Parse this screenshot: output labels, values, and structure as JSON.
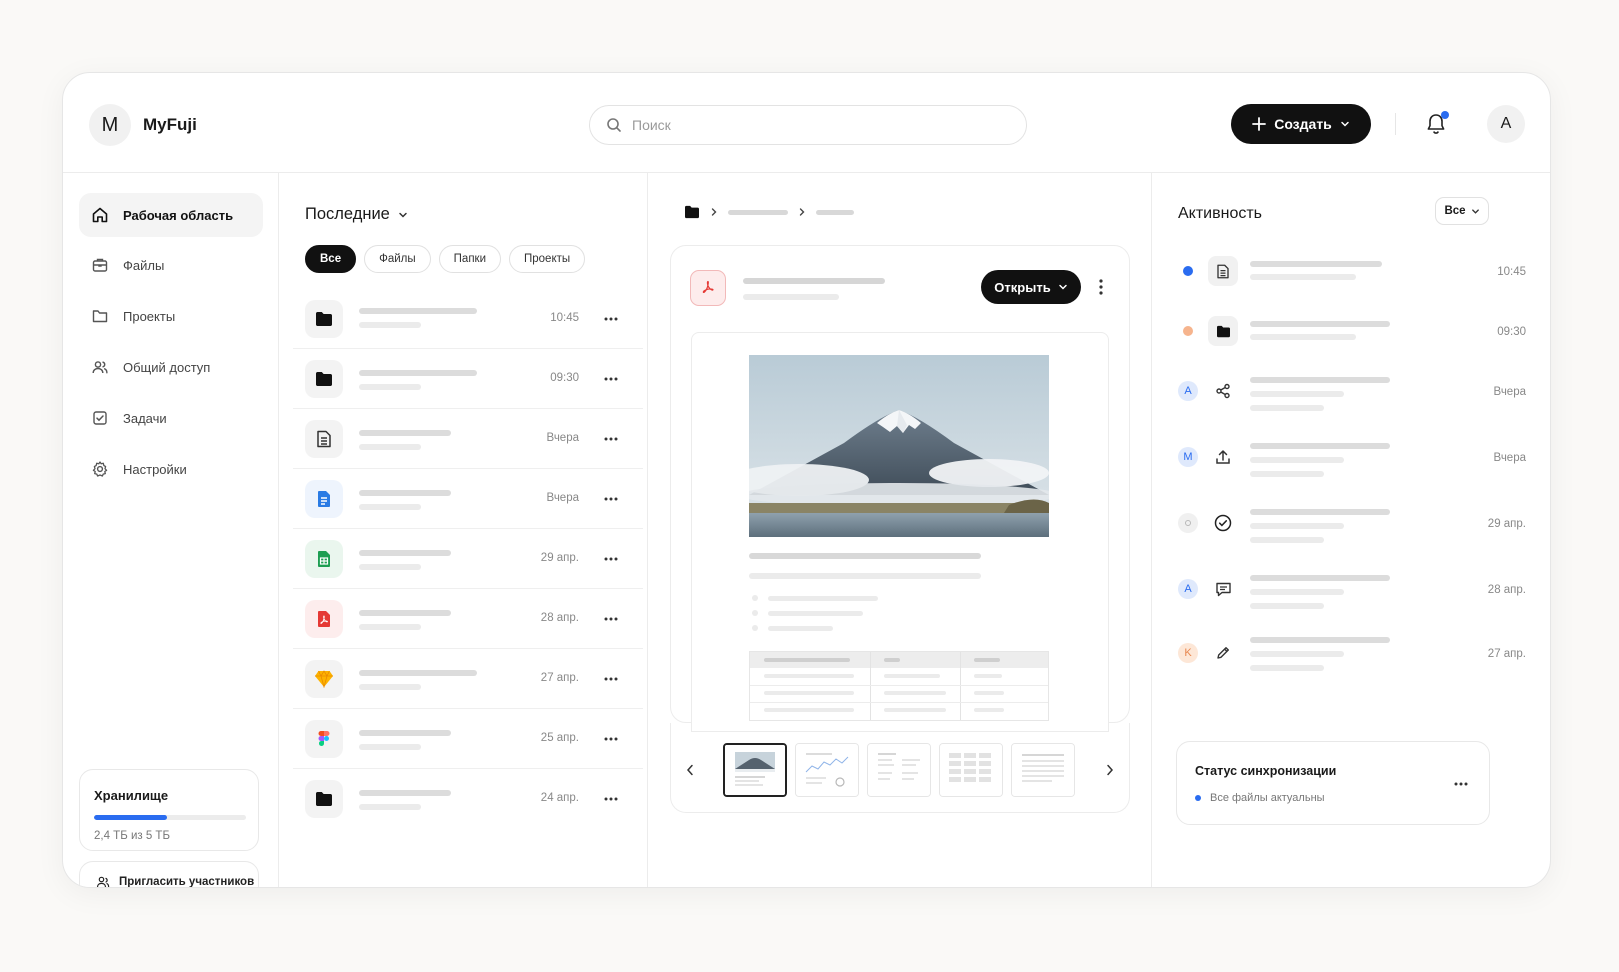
{
  "brand": {
    "initial": "M",
    "name": "MyFuji"
  },
  "search": {
    "placeholder": "Поиск",
    "value": ""
  },
  "header": {
    "create_label": "Создать",
    "user_initial": "A"
  },
  "sidebar": {
    "items": [
      {
        "label": "Рабочая область",
        "icon": "home-icon",
        "active": true
      },
      {
        "label": "Файлы",
        "icon": "briefcase-icon",
        "active": false
      },
      {
        "label": "Проекты",
        "icon": "folder-outline-icon",
        "active": false
      },
      {
        "label": "Общий доступ",
        "icon": "users-icon",
        "active": false
      },
      {
        "label": "Задачи",
        "icon": "checkbox-icon",
        "active": false
      },
      {
        "label": "Настройки",
        "icon": "gear-icon",
        "active": false
      }
    ],
    "storage": {
      "title": "Хранилище",
      "used_text": "2,4 ТБ из 5 ТБ",
      "used_fraction": 0.48
    },
    "invite_label": "Пригласить участников"
  },
  "recent": {
    "title": "Последние",
    "filters": [
      "Все",
      "Файлы",
      "Папки",
      "Проекты"
    ],
    "active_filter": 0,
    "rows": [
      {
        "icon": "folder-icon",
        "time": "10:45"
      },
      {
        "icon": "folder-icon",
        "time": "09:30"
      },
      {
        "icon": "document-icon",
        "time": "Вчера"
      },
      {
        "icon": "doc-blue-icon",
        "time": "Вчера"
      },
      {
        "icon": "sheet-green-icon",
        "time": "29 апр."
      },
      {
        "icon": "pdf-red-icon",
        "time": "28 апр."
      },
      {
        "icon": "sketch-gem-icon",
        "time": "27 апр."
      },
      {
        "icon": "figma-icon",
        "time": "25 апр."
      },
      {
        "icon": "folder-icon",
        "time": "24 апр."
      }
    ]
  },
  "preview": {
    "open_label": "Открыть"
  },
  "activity": {
    "title": "Активность",
    "filter_label": "Все",
    "rows": [
      {
        "marker": "blue-dot",
        "marker_text": "",
        "icon": "document-icon",
        "time": "10:45"
      },
      {
        "marker": "orange-dot",
        "marker_text": "",
        "icon": "folder-icon",
        "time": "09:30"
      },
      {
        "marker": "avatar-blue",
        "marker_text": "A",
        "icon": "share-icon",
        "time": "Вчера"
      },
      {
        "marker": "avatar-blue",
        "marker_text": "M",
        "icon": "upload-icon",
        "time": "Вчера"
      },
      {
        "marker": "avatar-grey",
        "marker_text": "",
        "icon": "check-circle-icon",
        "time": "29 апр."
      },
      {
        "marker": "avatar-blue",
        "marker_text": "A",
        "icon": "comment-icon",
        "time": "28 апр."
      },
      {
        "marker": "avatar-orange",
        "marker_text": "K",
        "icon": "pencil-icon",
        "time": "27 апр."
      }
    ],
    "sync": {
      "title": "Статус синхронизации",
      "status": "Все файлы актуальны"
    }
  },
  "colors": {
    "accent": "#2a6cf0",
    "dark": "#111111",
    "pdf_red": "#e53935",
    "sheet_green": "#1e9e52",
    "doc_blue": "#2a7be4"
  }
}
